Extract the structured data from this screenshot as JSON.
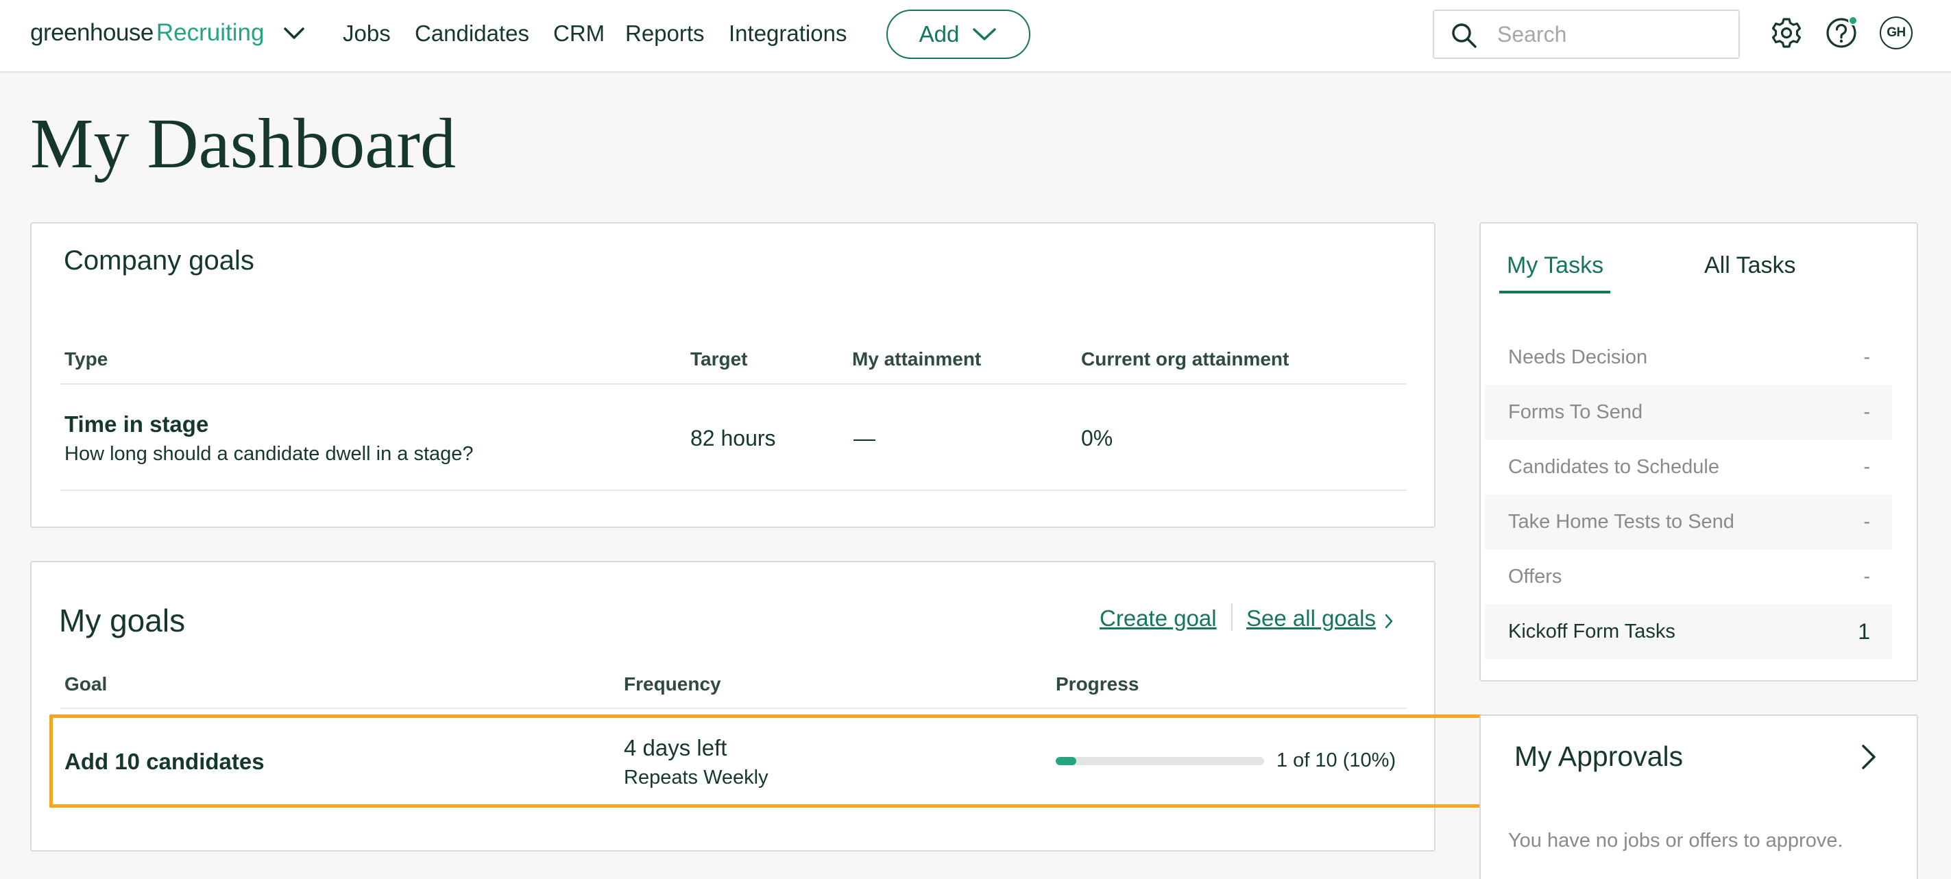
{
  "nav": {
    "logo_primary": "greenhouse",
    "logo_secondary": "Recruiting",
    "items": [
      "Jobs",
      "Candidates",
      "CRM",
      "Reports",
      "Integrations"
    ],
    "add_label": "Add",
    "search_placeholder": "Search",
    "avatar_initials": "GH"
  },
  "page": {
    "title": "My Dashboard"
  },
  "company_goals": {
    "title": "Company goals",
    "headers": [
      "Type",
      "Target",
      "My attainment",
      "Current org attainment"
    ],
    "rows": [
      {
        "type": "Time in stage",
        "description": "How long should a candidate dwell in a stage?",
        "target": "82 hours",
        "my_attainment": "—",
        "org_attainment": "0%"
      }
    ]
  },
  "my_goals": {
    "title": "My goals",
    "create_label": "Create goal",
    "see_all_label": "See all goals",
    "headers": [
      "Goal",
      "Frequency",
      "Progress"
    ],
    "rows": [
      {
        "goal": "Add 10 candidates",
        "frequency": "4 days left",
        "repeat": "Repeats Weekly",
        "progress_text": "1 of 10 (10%)",
        "progress_fraction": 0.1
      }
    ]
  },
  "tasks": {
    "tabs": [
      "My Tasks",
      "All Tasks"
    ],
    "active_tab": "My Tasks",
    "items": [
      {
        "label": "Needs Decision",
        "count": "-"
      },
      {
        "label": "Forms To Send",
        "count": "-"
      },
      {
        "label": "Candidates to Schedule",
        "count": "-"
      },
      {
        "label": "Take Home Tests to Send",
        "count": "-"
      },
      {
        "label": "Offers",
        "count": "-"
      },
      {
        "label": "Kickoff Form Tasks",
        "count": "1"
      }
    ]
  },
  "approvals": {
    "title": "My Approvals",
    "empty_text": "You have no jobs or offers to approve."
  },
  "colors": {
    "brand_dark": "#15372c",
    "brand_green": "#24a47f",
    "link_green": "#15765b",
    "highlight": "#f5a623"
  }
}
